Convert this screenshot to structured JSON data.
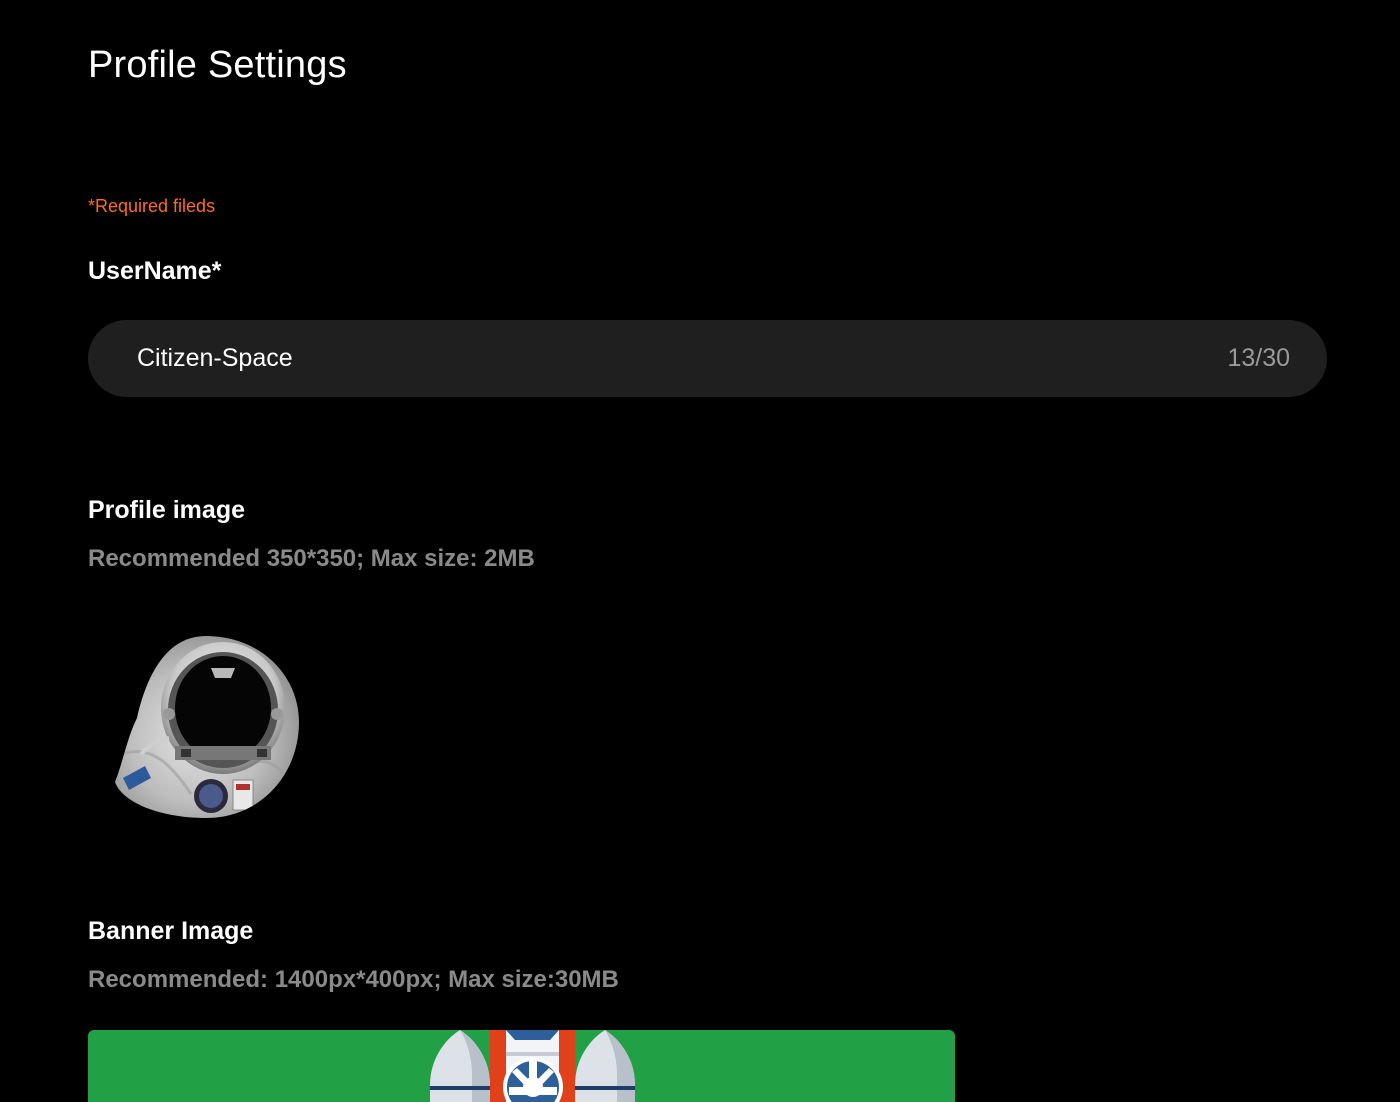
{
  "page": {
    "title": "Profile Settings",
    "required_note": "*Required fileds"
  },
  "username": {
    "label": "UserName*",
    "value": "Citizen-Space",
    "counter": "13/30"
  },
  "profile_image": {
    "label": "Profile image",
    "hint": "Recommended 350*350; Max size: 2MB"
  },
  "banner_image": {
    "label": "Banner Image",
    "hint": "Recommended: 1400px*400px; Max size:30MB"
  },
  "colors": {
    "background": "#000000",
    "required": "#ff6b1f",
    "input_bg": "#1f1f1f",
    "hint": "#8a8a8a",
    "banner_bg": "#22a045"
  }
}
